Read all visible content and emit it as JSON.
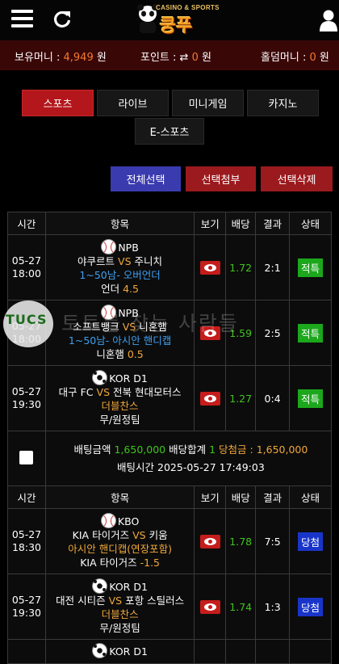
{
  "header": {
    "logo_top": "CASINO & SPORTS",
    "logo_main": "쿵푸"
  },
  "info": {
    "money_label": "보유머니 : ",
    "money_value": "4,949",
    "money_unit": " 원",
    "point_label": "포인트 : ",
    "point_value": "0",
    "point_unit": " 원",
    "holdem_label": "홀덤머니 : ",
    "holdem_value": "0",
    "holdem_unit": " 원"
  },
  "tabs": [
    "스포츠",
    "라이브",
    "미니게임",
    "카지노",
    "E-스포츠"
  ],
  "actions": {
    "select_all": "전체선택",
    "select_attach": "선택첨부",
    "select_delete": "선택삭제"
  },
  "columns": [
    "시간",
    "항목",
    "보기",
    "배당",
    "결과",
    "상태"
  ],
  "bet1": {
    "rows": [
      {
        "date": "05-27",
        "time": "18:00",
        "league": "NPB",
        "home": "야쿠르트",
        "vs": "VS",
        "away": "주니치",
        "market": "1~50남- 오버언더",
        "pick": "언더",
        "line": "4.5",
        "odds": "1.72",
        "result": "2:1",
        "status": "적특"
      },
      {
        "date": "05-27",
        "time": "18:00",
        "league": "NPB",
        "home": "소프트뱅크",
        "vs": "VS",
        "away": "니혼햄",
        "market": "1~50남- 아시안 핸디캡",
        "pick": "니혼햄",
        "line": "0.5",
        "odds": "1.59",
        "result": "2:5",
        "status": "적특"
      },
      {
        "date": "05-27",
        "time": "19:30",
        "league": "KOR D1",
        "home": "대구 FC",
        "vs": "VS",
        "away": "전북 현대모터스",
        "market": "더블찬스",
        "pick": "무/원정팀",
        "line": "",
        "odds": "1.27",
        "result": "0:4",
        "status": "적특"
      }
    ],
    "summary": {
      "amount_label": "배팅금액",
      "amount": "1,650,000",
      "total_label": "배당합계",
      "total": "1",
      "win_label": "당첨금 : ",
      "win": "1,650,000",
      "time_label": "배팅시간",
      "time": "2025-05-27 17:49:03"
    }
  },
  "bet2": {
    "rows": [
      {
        "date": "05-27",
        "time": "18:30",
        "league": "KBO",
        "home": "KIA 타이거즈",
        "vs": "VS",
        "away": "키움",
        "market": "아시안 핸디캡(연장포함)",
        "pick": "KIA 타이거즈",
        "line": "-1.5",
        "odds": "1.78",
        "result": "7:5",
        "status": "당첨"
      },
      {
        "date": "05-27",
        "time": "19:30",
        "league": "KOR D1",
        "home": "대전 시티즌",
        "vs": "VS",
        "away": "포항 스틸러스",
        "market": "더블찬스",
        "pick": "무/원정팀",
        "line": "",
        "odds": "1.74",
        "result": "1:3",
        "status": "당첨"
      }
    ],
    "partial_league": "KOR D1"
  },
  "watermark": {
    "badge": "TUCS",
    "text": "토토를 찾는 사람들"
  },
  "colors": {
    "info_bg": "#3a0707",
    "accent_red": "#b3171b",
    "odds_green": "#3ec51b",
    "status_hit": "#1ca71c",
    "status_win": "#1935c9",
    "select_all_bg": "#3b3bb0"
  }
}
